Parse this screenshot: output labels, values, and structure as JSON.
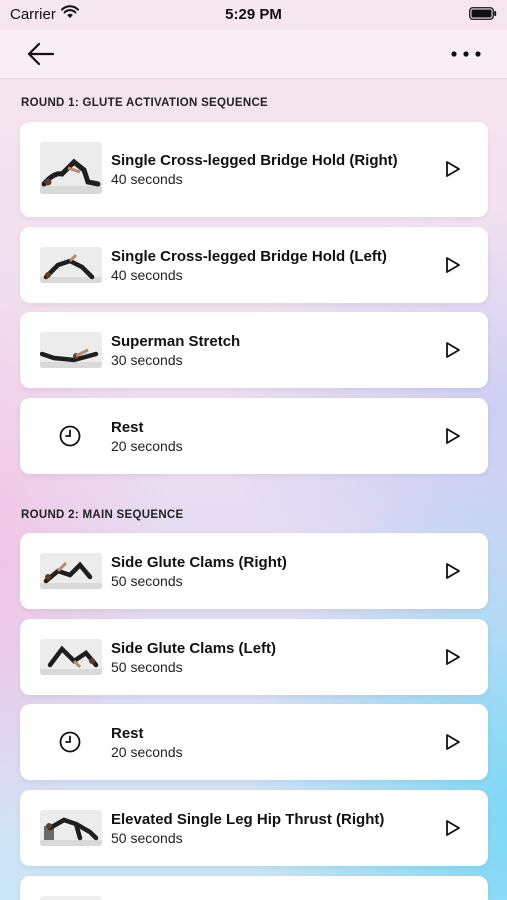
{
  "status_bar": {
    "carrier": "Carrier",
    "time": "5:29 PM"
  },
  "nav": {
    "back_icon": "arrow-left-icon",
    "more_icon": "more-horizontal-icon"
  },
  "rounds": [
    {
      "title": "ROUND 1: GLUTE ACTIVATION SEQUENCE",
      "items": [
        {
          "title": "Single Cross-legged Bridge Hold (Right)",
          "duration": "40 seconds",
          "kind": "exercise"
        },
        {
          "title": "Single Cross-legged Bridge Hold (Left)",
          "duration": "40 seconds",
          "kind": "exercise"
        },
        {
          "title": "Superman Stretch",
          "duration": "30 seconds",
          "kind": "exercise"
        },
        {
          "title": "Rest",
          "duration": "20 seconds",
          "kind": "rest"
        }
      ]
    },
    {
      "title": "ROUND 2: MAIN SEQUENCE",
      "items": [
        {
          "title": "Side Glute Clams (Right)",
          "duration": "50 seconds",
          "kind": "exercise"
        },
        {
          "title": "Side Glute Clams (Left)",
          "duration": "50 seconds",
          "kind": "exercise"
        },
        {
          "title": "Rest",
          "duration": "20 seconds",
          "kind": "rest"
        },
        {
          "title": "Elevated Single Leg Hip Thrust (Right)",
          "duration": "50 seconds",
          "kind": "exercise"
        }
      ]
    }
  ]
}
